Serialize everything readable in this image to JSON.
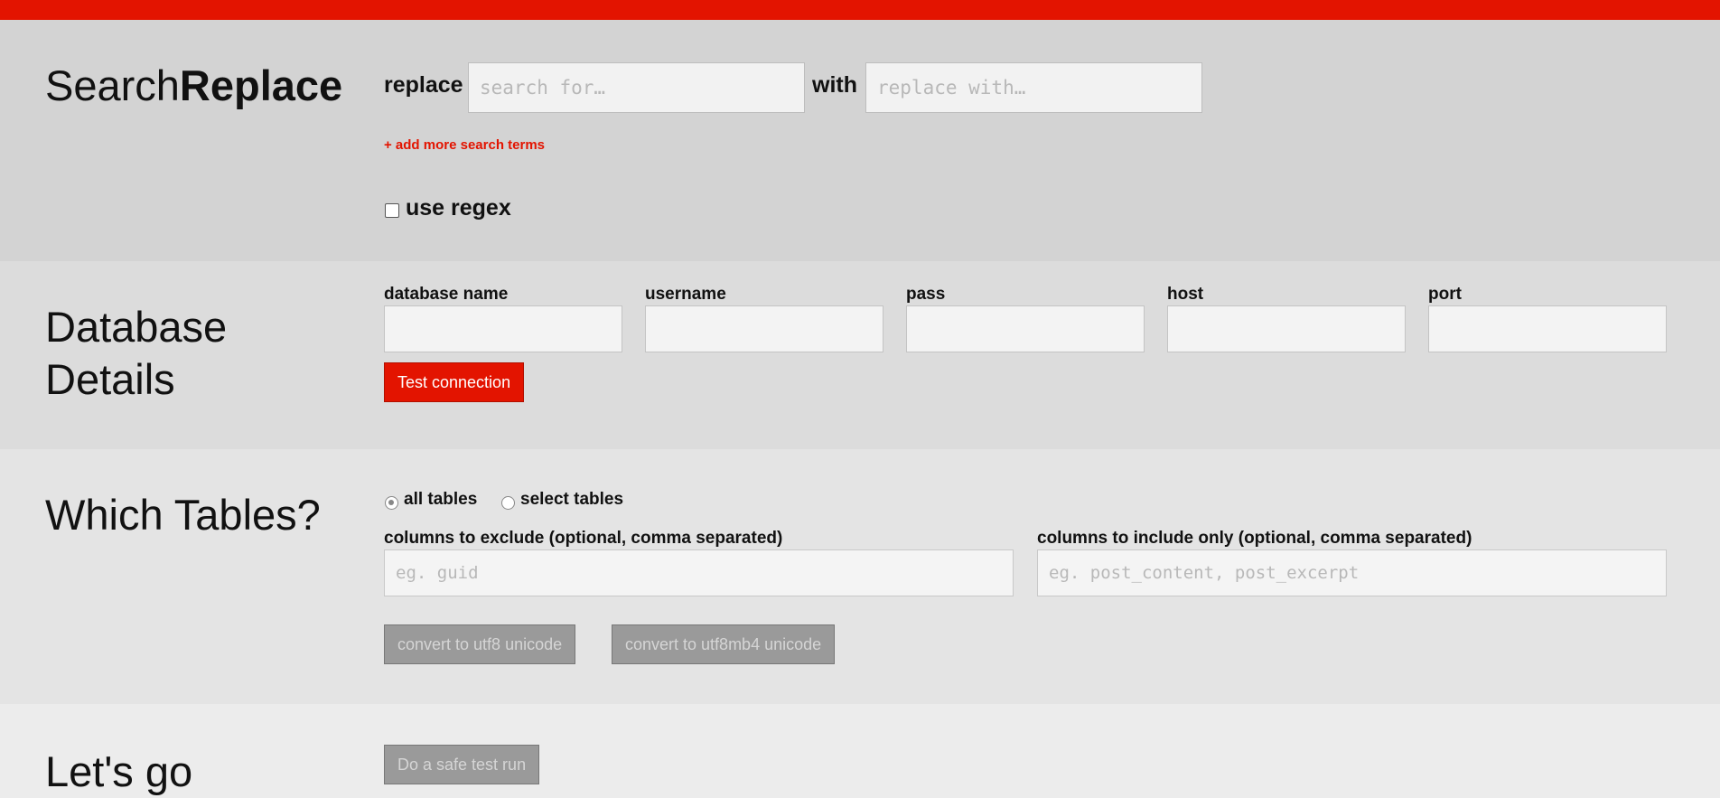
{
  "colors": {
    "accent": "#e31400",
    "disabled_button": "#9a9a9a"
  },
  "search": {
    "title_light": "Search",
    "title_bold": "Replace",
    "replace_label": "replace",
    "search_placeholder": "search for…",
    "with_label": "with",
    "replace_placeholder": "replace with…",
    "add_more_label": "+ add more search terms",
    "use_regex_label": "use regex",
    "use_regex_checked": false
  },
  "database": {
    "title_line1": "Database",
    "title_line2": "Details",
    "fields": [
      {
        "label": "database name",
        "value": ""
      },
      {
        "label": "username",
        "value": ""
      },
      {
        "label": "pass",
        "value": ""
      },
      {
        "label": "host",
        "value": ""
      },
      {
        "label": "port",
        "value": ""
      }
    ],
    "test_button": "Test connection"
  },
  "tables": {
    "title": "Which Tables?",
    "all_tables_label": "all tables",
    "select_tables_label": "select tables",
    "selected": "all tables",
    "exclude_label": "columns to exclude (optional, comma separated)",
    "exclude_placeholder": "eg. guid",
    "include_label": "columns to include only (optional, comma separated)",
    "include_placeholder": "eg. post_content, post_excerpt",
    "utf8_button": "convert to utf8 unicode",
    "utf8mb4_button": "convert to utf8mb4 unicode"
  },
  "go": {
    "title": "Let's go",
    "dry_run_button": "Do a safe test run"
  }
}
